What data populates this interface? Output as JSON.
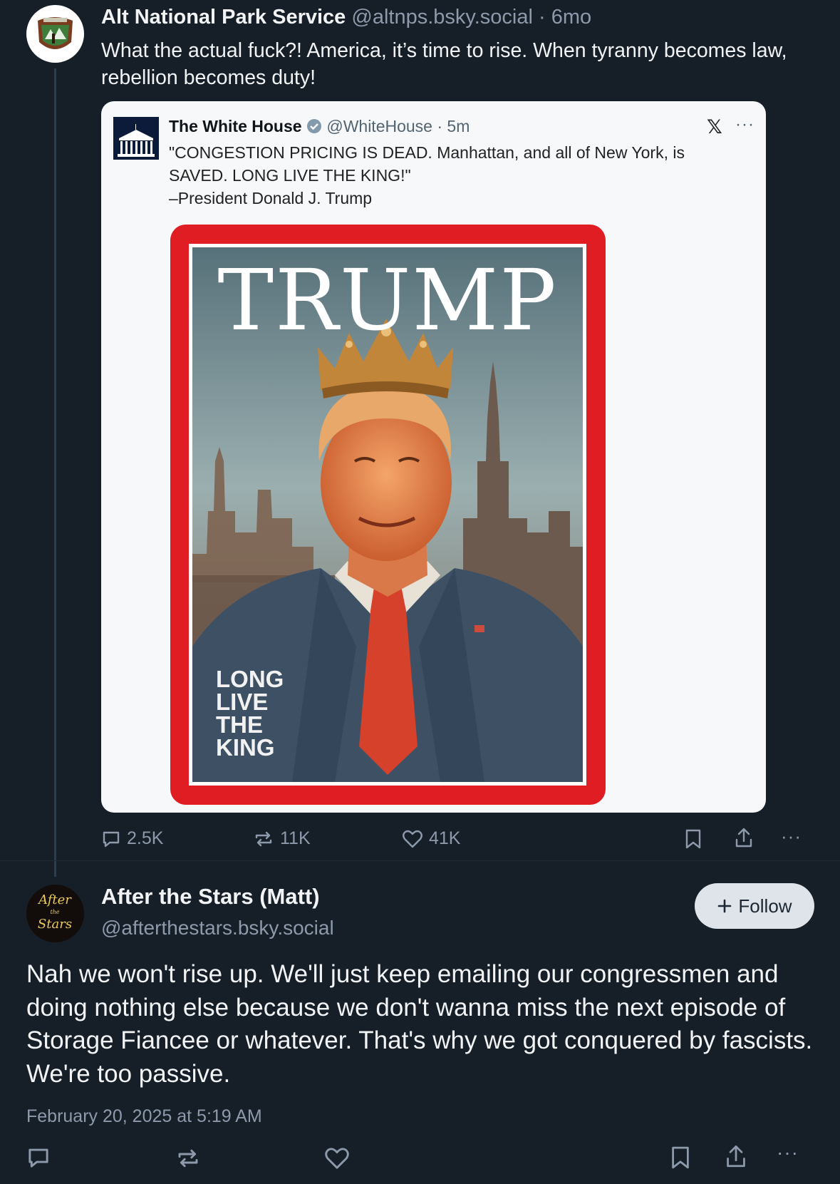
{
  "post1": {
    "author_name": "Alt National Park Service",
    "handle": "@altnps.bsky.social",
    "time_sep": "·",
    "time": "6mo",
    "text": "What the actual fuck?! America, it’s time to rise. When tyranny becomes law, rebellion becomes duty!",
    "embed": {
      "author_name": "The White House",
      "handle": "@WhiteHouse",
      "time": "· 5m",
      "x_icon": "x-logo",
      "more": "···",
      "text_line1": "\"CONGESTION PRICING IS DEAD. Manhattan, and all of New York, is SAVED. LONG LIVE THE KING!\"",
      "text_line2": "–President Donald J. Trump",
      "cover_title": "TRUMP",
      "cover_caption": [
        "LONG",
        "LIVE",
        "THE",
        "KING"
      ]
    },
    "actions": {
      "replies": "2.5K",
      "reposts": "11K",
      "likes": "41K",
      "more": "···"
    }
  },
  "post2": {
    "author_name": "After the Stars (Matt)",
    "handle": "@afterthestars.bsky.social",
    "avatar_text": [
      "After",
      "the",
      "Stars"
    ],
    "follow_label": "Follow",
    "text": "Nah we won't rise up. We'll just keep emailing our congressmen and doing nothing else because we don't wanna miss the next episode of Storage Fiancee or whatever. That's why we got conquered by fascists. We're too passive.",
    "date": "February 20, 2025 at 5:19 AM",
    "more": "···"
  },
  "colors": {
    "background": "#161e27",
    "muted_text": "#8d9aab",
    "cover_red": "#e11d24",
    "follow_bg": "#dfe4ea"
  }
}
